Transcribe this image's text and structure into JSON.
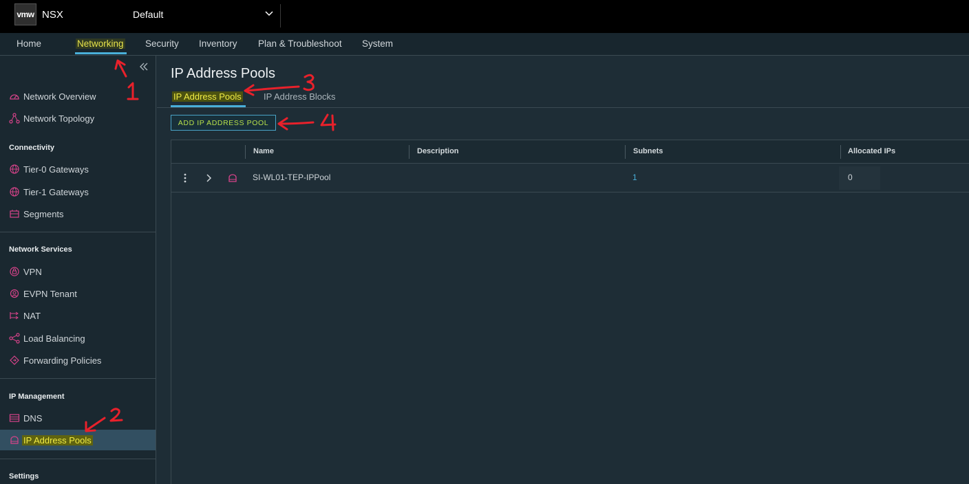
{
  "topbar": {
    "logo_text": "vmw",
    "app_name": "NSX",
    "project": "Default"
  },
  "mainnav": {
    "tabs": [
      {
        "label": "Home"
      },
      {
        "label": "Networking",
        "active": true
      },
      {
        "label": "Security"
      },
      {
        "label": "Inventory"
      },
      {
        "label": "Plan & Troubleshoot"
      },
      {
        "label": "System"
      }
    ]
  },
  "sidebar": {
    "top_items": [
      {
        "label": "Network Overview",
        "icon": "gauge-icon"
      },
      {
        "label": "Network Topology",
        "icon": "topology-icon"
      }
    ],
    "sections": [
      {
        "header": "Connectivity",
        "items": [
          {
            "label": "Tier-0 Gateways",
            "icon": "globe-icon"
          },
          {
            "label": "Tier-1 Gateways",
            "icon": "globe-icon"
          },
          {
            "label": "Segments",
            "icon": "segment-icon"
          }
        ]
      },
      {
        "header": "Network Services",
        "items": [
          {
            "label": "VPN",
            "icon": "vpn-icon"
          },
          {
            "label": "EVPN Tenant",
            "icon": "evpn-icon"
          },
          {
            "label": "NAT",
            "icon": "nat-icon"
          },
          {
            "label": "Load Balancing",
            "icon": "load-balancer-icon"
          },
          {
            "label": "Forwarding Policies",
            "icon": "forwarding-icon"
          }
        ]
      },
      {
        "header": "IP Management",
        "items": [
          {
            "label": "DNS",
            "icon": "dns-icon"
          },
          {
            "label": "IP Address Pools",
            "icon": "ip-pool-icon",
            "active": true
          }
        ]
      },
      {
        "header": "Settings",
        "items": []
      }
    ]
  },
  "content": {
    "title": "IP Address Pools",
    "subtabs": [
      {
        "label": "IP Address Pools",
        "active": true
      },
      {
        "label": "IP Address Blocks"
      }
    ],
    "add_button": "ADD IP ADDRESS POOL",
    "grid": {
      "columns": [
        "Name",
        "Description",
        "Subnets",
        "Allocated IPs"
      ],
      "rows": [
        {
          "name": "SI-WL01-TEP-IPPool",
          "description": "",
          "subnets": "1",
          "allocated_ips": "0"
        }
      ]
    }
  },
  "annotations": {
    "marks": [
      "1",
      "2",
      "3",
      "4"
    ],
    "color": "#e8212b"
  },
  "colors": {
    "accent": "#49afd9",
    "highlight": "#f1ec45",
    "icon": "#d7438a"
  }
}
